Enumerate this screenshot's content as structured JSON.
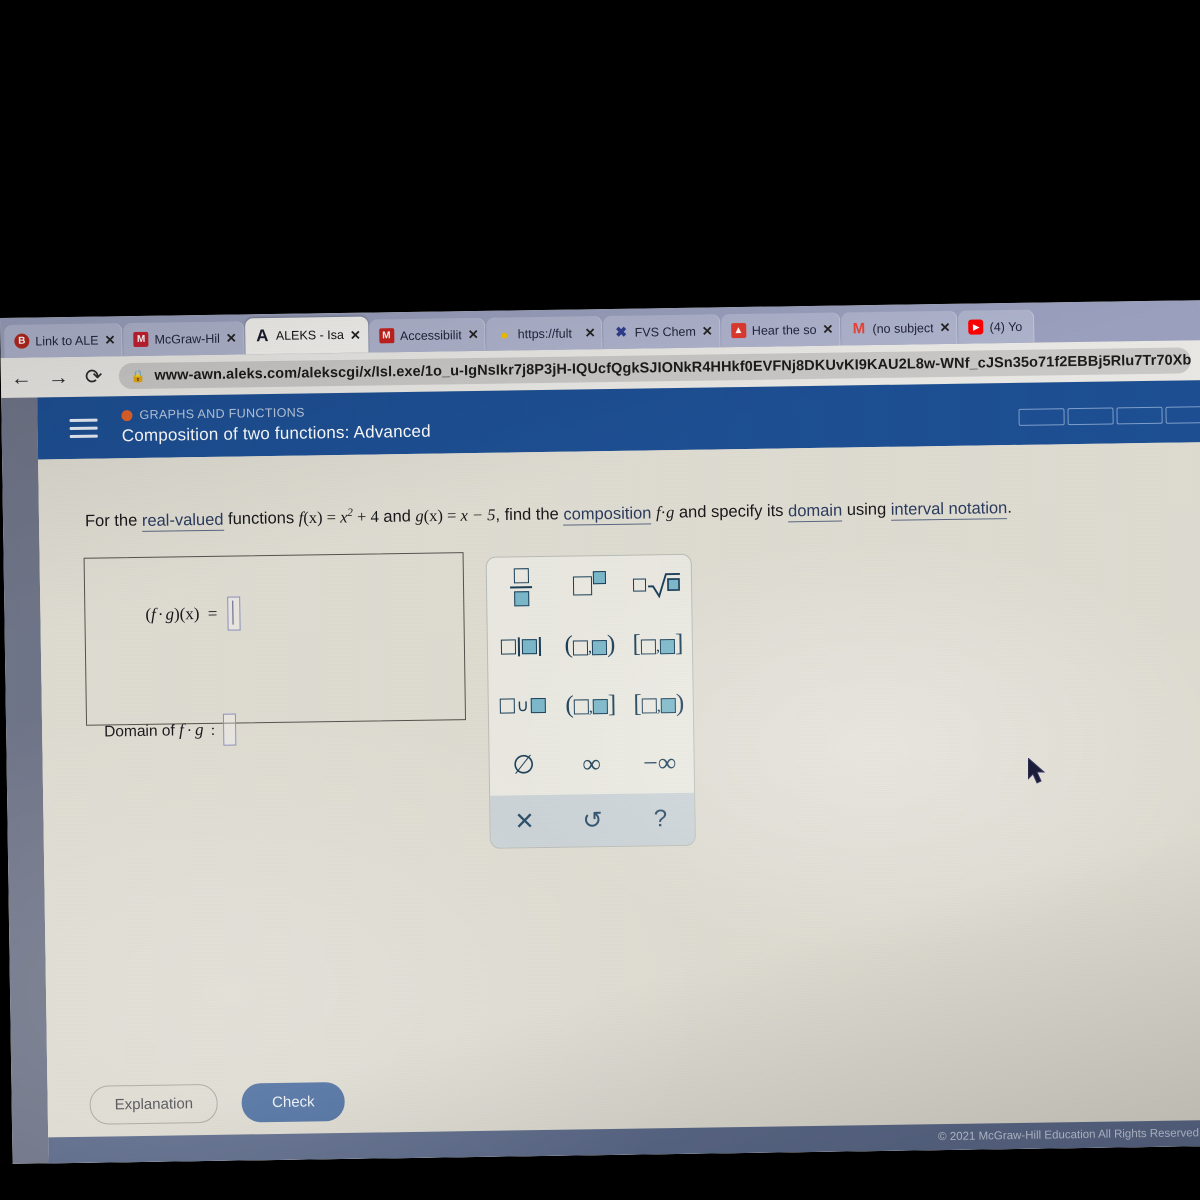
{
  "browser": {
    "tabs": [
      {
        "label": "Link to ALE",
        "favicon": "B",
        "favicon_color": "#b3261e",
        "active": false
      },
      {
        "label": "McGraw-Hil",
        "favicon": "M",
        "favicon_color": "#c22030",
        "active": false
      },
      {
        "label": "ALEKS - Isa",
        "favicon": "A",
        "favicon_color": "#1a1a2e",
        "active": true
      },
      {
        "label": "Accessibilit",
        "favicon": "M",
        "favicon_color": "#c5221f",
        "active": false
      },
      {
        "label": "https://fult",
        "favicon": "●",
        "favicon_color": "#f2c100",
        "active": false
      },
      {
        "label": "FVS Chem",
        "favicon": "✖",
        "favicon_color": "#2c3e8f",
        "active": false
      },
      {
        "label": "Hear the so",
        "favicon": "▲",
        "favicon_color": "#e03a2f",
        "active": false
      },
      {
        "label": "(no subject",
        "favicon": "M",
        "favicon_color": "#ea4335",
        "active": false
      },
      {
        "label": "(4) Yo",
        "favicon": "▶",
        "favicon_color": "#ff0000",
        "active": false
      }
    ],
    "close_glyph": "✕",
    "back_glyph": "←",
    "forward_glyph": "→",
    "reload_glyph": "⟳",
    "lock_glyph": "🔒",
    "url": "www-awn.aleks.com/alekscgi/x/Isl.exe/1o_u-IgNsIkr7j8P3jH-IQUcfQgkSJIONkR4HHkf0EVFNj8DKUvKI9KAU2L8w-WNf_cJSn35o71f2EBBj5Rlu7Tr70Xb"
  },
  "aleks": {
    "category": "GRAPHS AND FUNCTIONS",
    "title": "Composition of two functions: Advanced",
    "progress_segments": 4,
    "chevron_glyph": "⌄",
    "prompt": {
      "p1": "For the ",
      "link1": "real-valued",
      "p2": " functions ",
      "f_name": "f",
      "f_arg": "(x)",
      "f_eq": " = ",
      "f_base": "x",
      "f_exp": "2",
      "f_rest": " + 4",
      "p3": " and ",
      "g_name": "g",
      "g_arg": "(x)",
      "g_eq": " = ",
      "g_rhs": "x − 5",
      "p4": ", find the ",
      "link2": "composition",
      "p5": " ",
      "comp_f": "f",
      "comp_dot": "·",
      "comp_g": "g",
      "p6": " and specify its ",
      "link3": "domain",
      "p7": " using ",
      "link4": "interval notation",
      "p8": "."
    },
    "answer": {
      "expr_label_open": "(",
      "expr_f": "f",
      "expr_dot": "·",
      "expr_g": "g",
      "expr_close": ")",
      "expr_x": "(x)",
      "expr_equals": "=",
      "expr_value": "",
      "domain_label": "Domain of",
      "domain_f": "f",
      "domain_dot": "·",
      "domain_g": "g",
      "domain_colon": ":",
      "domain_value": ""
    },
    "keypad": {
      "keys": [
        {
          "name": "fraction",
          "type": "frac"
        },
        {
          "name": "exponent",
          "type": "power"
        },
        {
          "name": "nth-root",
          "type": "root"
        },
        {
          "name": "absolute-value",
          "type": "abs"
        },
        {
          "name": "open-open-interval",
          "type": "interval",
          "open": "(",
          "close": ")"
        },
        {
          "name": "closed-closed-interval",
          "type": "interval",
          "open": "[",
          "close": "]"
        },
        {
          "name": "union",
          "type": "union"
        },
        {
          "name": "open-closed-interval",
          "type": "interval",
          "open": "(",
          "close": "]"
        },
        {
          "name": "closed-open-interval",
          "type": "interval",
          "open": "[",
          "close": ")"
        },
        {
          "name": "empty-set",
          "type": "glyph",
          "glyph": "∅"
        },
        {
          "name": "infinity",
          "type": "glyph",
          "glyph": "∞"
        },
        {
          "name": "negative-infinity",
          "type": "glyph",
          "glyph": "−∞"
        }
      ],
      "footer": [
        {
          "name": "clear-button",
          "glyph": "✕"
        },
        {
          "name": "undo-button",
          "glyph": "↺"
        },
        {
          "name": "help-button",
          "glyph": "?"
        }
      ],
      "union_glyph": "∪",
      "comma": ","
    },
    "buttons": {
      "explanation": "Explanation",
      "check": "Check"
    },
    "copyright": "© 2021 McGraw-Hill Education  All Rights Reserved."
  },
  "colors": {
    "aleks_blue": "#1d4f93",
    "check_blue": "#4d6fa0",
    "category_orange": "#e0622a",
    "keypad_teal": "#1b3f58",
    "input_purple": "#8d8fbe"
  }
}
